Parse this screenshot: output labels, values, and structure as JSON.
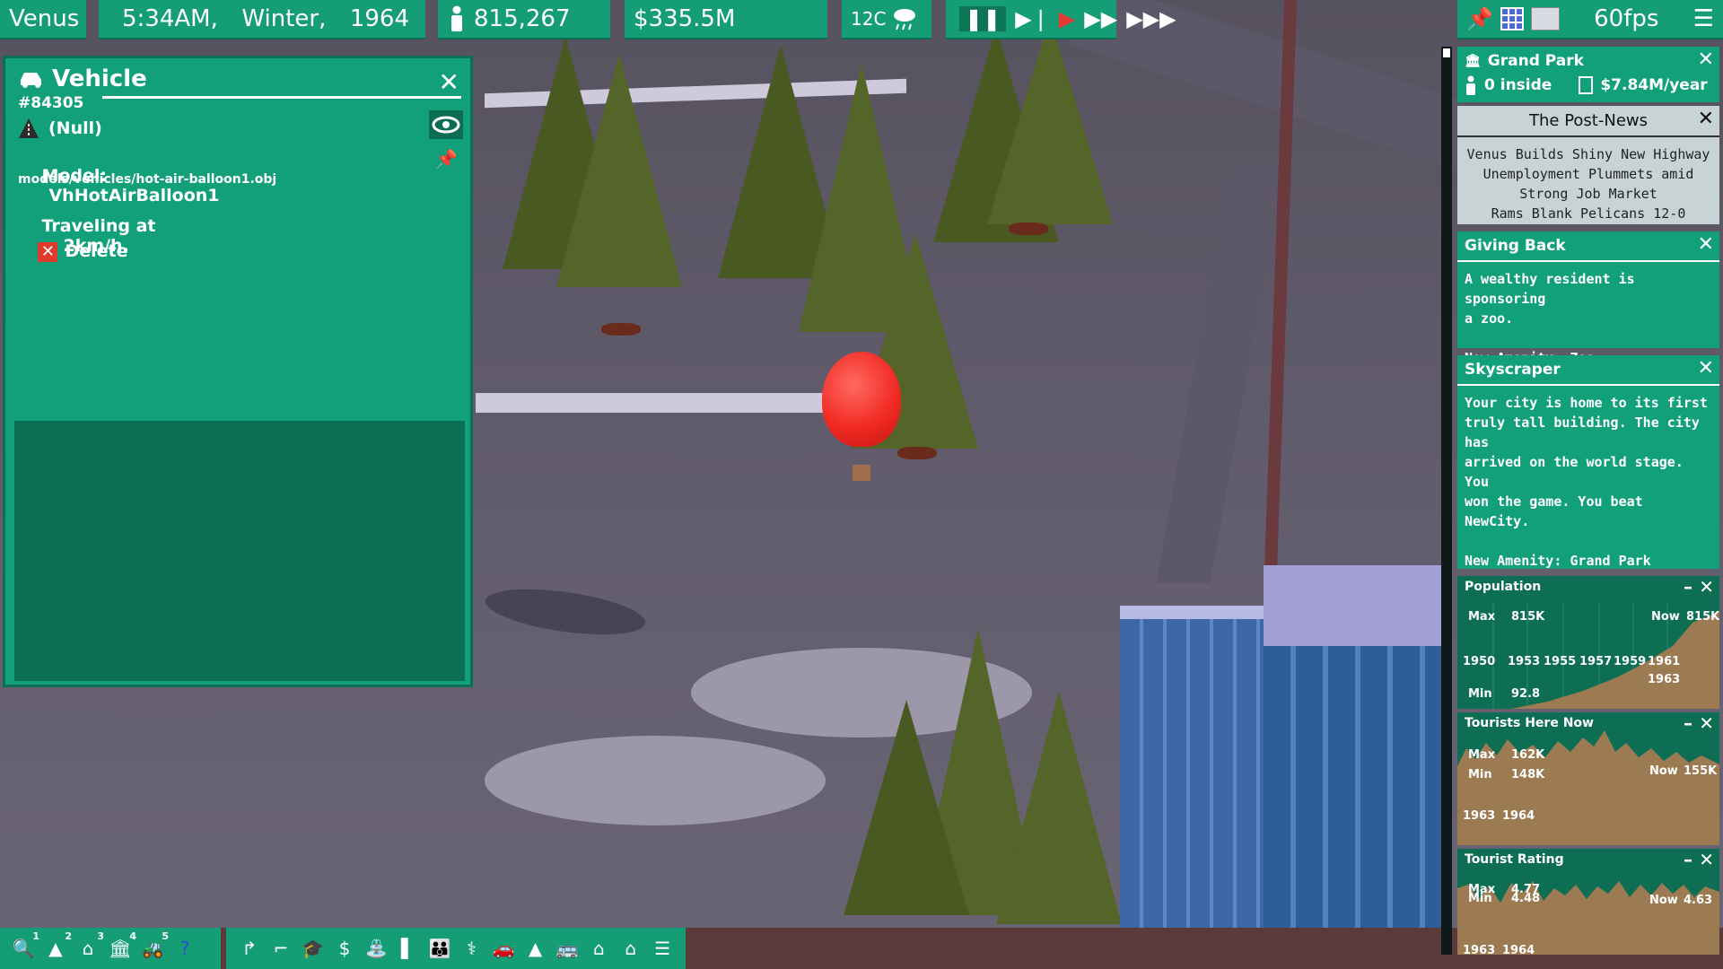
{
  "hud": {
    "city": "Venus",
    "time": "5:34AM,",
    "season": "Winter,",
    "year": "1964",
    "population": "815,267",
    "money": "$335.5M",
    "temperature": "12C",
    "fps": "60fps"
  },
  "vehicle_panel": {
    "title": "Vehicle",
    "id": "#84305",
    "null_label": "(Null)",
    "model_label": "Model:",
    "model_value": "VhHotAirBalloon1",
    "path": "models/vehicles/hot-air-balloon1.obj",
    "traveling_label": "Traveling at",
    "speed": "2km/h.",
    "delete_label": "Delete"
  },
  "grand_park": {
    "title": "Grand Park",
    "inside": "0 inside",
    "income": "$7.84M/year"
  },
  "news": {
    "title": "The Post-News",
    "headlines": "Venus Builds Shiny New Highway\nUnemployment Plummets amid\nStrong Job Market\nRams Blank Pelicans 12-0"
  },
  "giving_back": {
    "title": "Giving Back",
    "body": "A wealthy resident is sponsoring\na zoo.\n\nNew Amenity: Zoo"
  },
  "skyscraper": {
    "title": "Skyscraper",
    "body": "Your city is home to its first\ntruly tall building. The city has\narrived on the world stage. You\nwon the game. You beat\nNewCity.\n\nNew Amenity: Grand Park\n\nCongratulations!"
  },
  "graphs": {
    "population": {
      "title": "Population",
      "max_label": "Max",
      "max": "815K",
      "now_label": "Now",
      "now": "815K",
      "min_label": "Min",
      "min": "92.8",
      "years": [
        "1950",
        "1953",
        "1955",
        "1957",
        "1959",
        "1961",
        "1963"
      ]
    },
    "tourists": {
      "title": "Tourists Here Now",
      "max_label": "Max",
      "max": "162K",
      "min_label": "Min",
      "min": "148K",
      "now_label": "Now",
      "now": "155K",
      "years": [
        "1963",
        "1964"
      ]
    },
    "rating": {
      "title": "Tourist Rating",
      "max_label": "Max",
      "max": "4.77",
      "min_label": "Min",
      "min": "4.48",
      "now_label": "Now",
      "now": "4.63",
      "years": [
        "1963",
        "1964"
      ]
    }
  },
  "toolbar": {
    "numbers": [
      "1",
      "2",
      "3",
      "4",
      "5"
    ]
  },
  "colors": {
    "panel": "#12a07a",
    "panel_dark": "#0e6e54",
    "balloon": "#f12a24",
    "graph_fill": "#9c7a52"
  }
}
